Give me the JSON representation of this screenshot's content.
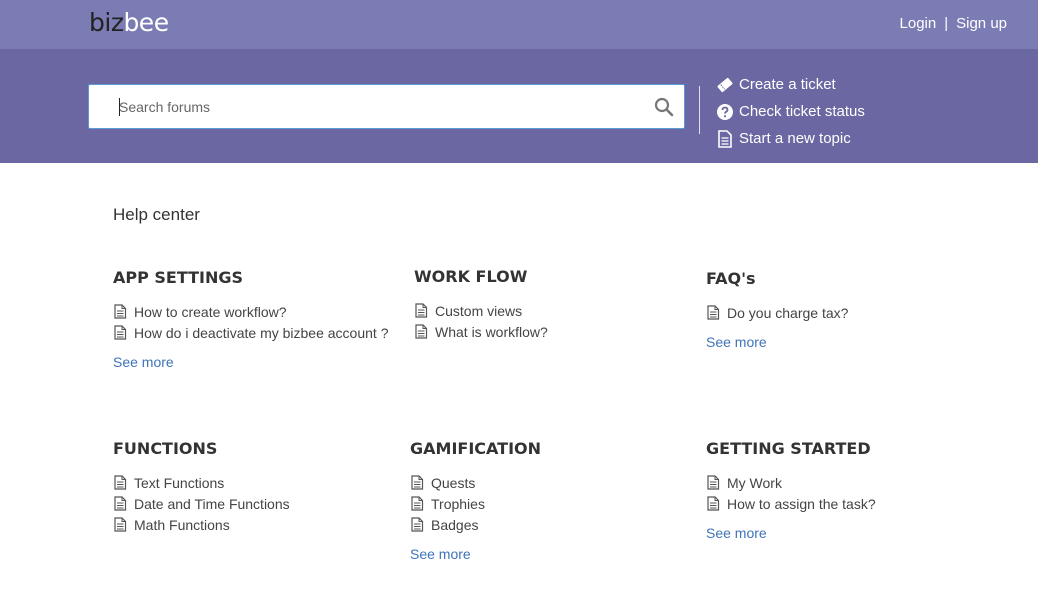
{
  "header": {
    "logo_part1": "biz",
    "logo_part2": "bee",
    "login": "Login",
    "separator": "|",
    "signup": "Sign up"
  },
  "search": {
    "placeholder": "Search forums"
  },
  "actions": [
    {
      "label": "Create a ticket",
      "icon": "ticket-icon"
    },
    {
      "label": "Check ticket status",
      "icon": "question-circle-icon"
    },
    {
      "label": "Start a new topic",
      "icon": "document-icon"
    }
  ],
  "help_center": {
    "title": "Help center",
    "categories": [
      {
        "title": "APP SETTINGS",
        "items": [
          "How to create workflow?",
          "How do i deactivate my bizbee account ?"
        ],
        "more": "See more"
      },
      {
        "title": "WORK FLOW",
        "items": [
          "Custom views",
          "What is workflow?"
        ],
        "more": ""
      },
      {
        "title": "FAQ's",
        "items": [
          "Do you charge tax?"
        ],
        "more": "See more"
      },
      {
        "title": "FUNCTIONS",
        "items": [
          "Text Functions",
          "Date and Time Functions",
          "Math Functions"
        ],
        "more": ""
      },
      {
        "title": "GAMIFICATION",
        "items": [
          "Quests",
          "Trophies",
          "Badges"
        ],
        "more": "See more"
      },
      {
        "title": "GETTING STARTED",
        "items": [
          "My Work",
          "How to assign the task?"
        ],
        "more": "See more"
      }
    ]
  },
  "colors": {
    "topbar": "#7c7cb4",
    "band": "#6a67a2",
    "link": "#3f74b8"
  }
}
